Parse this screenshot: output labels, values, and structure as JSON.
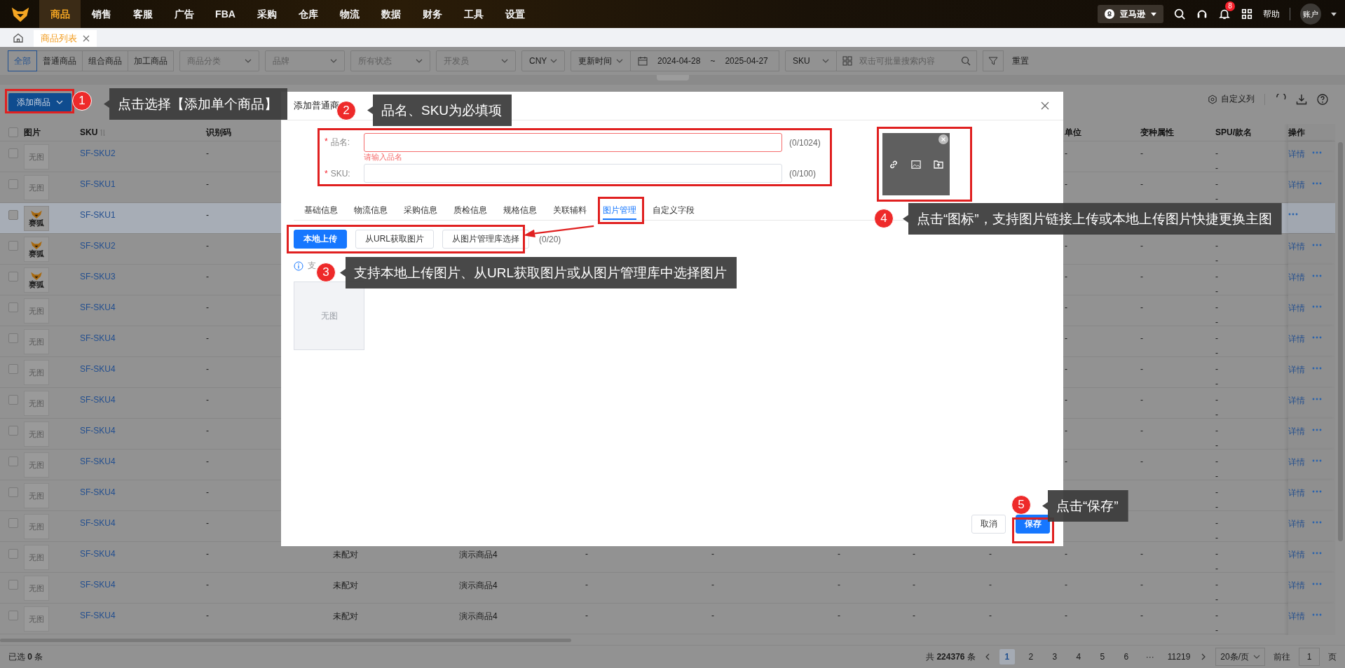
{
  "nav": {
    "items": [
      {
        "label": "商品",
        "selected": true
      },
      {
        "label": "销售",
        "selected": false
      },
      {
        "label": "客服",
        "selected": false
      },
      {
        "label": "广告",
        "selected": false
      },
      {
        "label": "FBA",
        "selected": false
      },
      {
        "label": "采购",
        "selected": false
      },
      {
        "label": "仓库",
        "selected": false
      },
      {
        "label": "物流",
        "selected": false
      },
      {
        "label": "数据",
        "selected": false
      },
      {
        "label": "财务",
        "selected": false
      },
      {
        "label": "工具",
        "selected": false
      },
      {
        "label": "设置",
        "selected": false
      }
    ],
    "marketplace": "亚马逊",
    "notification_count": "8",
    "help": "帮助",
    "account": "账户"
  },
  "tabs": [
    {
      "label": "商品列表",
      "selected": true
    }
  ],
  "filters": {
    "types": [
      {
        "label": "全部",
        "selected": true
      },
      {
        "label": "普通商品",
        "selected": false
      },
      {
        "label": "组合商品",
        "selected": false
      },
      {
        "label": "加工商品",
        "selected": false
      }
    ],
    "selects": [
      {
        "placeholder": "商品分类"
      },
      {
        "placeholder": "品牌"
      },
      {
        "placeholder": "所有状态"
      },
      {
        "placeholder": "开发员"
      },
      {
        "value": "CNY"
      }
    ],
    "date_field": "更新时间",
    "date_start": "2024-04-28",
    "date_sep": "~",
    "date_end": "2025-04-27",
    "search_field": "SKU",
    "search": {
      "placeholder": "双击可批量搜索内容"
    },
    "reset": "重置"
  },
  "toolbar": {
    "add_button": "添加商品",
    "custom_columns": "自定义列"
  },
  "table": {
    "header_checked": false,
    "header": {
      "image": "图片",
      "sku": "SKU",
      "code": "识别码",
      "unit": "单位",
      "variant": "变种属性",
      "spu": "SPU/款名",
      "actions": "操作"
    },
    "rows": [
      {
        "checked": false,
        "highlighted": false,
        "image": {
          "kind": "empty",
          "caption": "无图"
        },
        "sku": "SF-SKU2",
        "code": "-",
        "unit": "-",
        "variant": "-",
        "spu": [
          "-",
          "-"
        ],
        "detail": "详情"
      },
      {
        "checked": false,
        "highlighted": false,
        "image": {
          "kind": "empty",
          "caption": "无图"
        },
        "sku": "SF-SKU1",
        "code": "-",
        "unit": "-",
        "variant": "-",
        "spu": [
          "-",
          "-"
        ],
        "detail": "详情"
      },
      {
        "checked": false,
        "highlighted": true,
        "image": {
          "kind": "logo",
          "caption": "赛狐"
        },
        "sku": "SF-SKU1",
        "code": "-"
      },
      {
        "checked": false,
        "highlighted": false,
        "image": {
          "kind": "logo",
          "caption": "赛狐"
        },
        "sku": "SF-SKU2",
        "code": "-",
        "unit": "-",
        "variant": "-",
        "spu": [
          "-",
          "-"
        ],
        "detail": "详情"
      },
      {
        "checked": false,
        "highlighted": false,
        "image": {
          "kind": "logo",
          "caption": "赛狐"
        },
        "sku": "SF-SKU3",
        "code": "-",
        "unit": "-",
        "variant": "-",
        "spu": [
          "-",
          "-"
        ],
        "detail": "详情"
      },
      {
        "checked": false,
        "highlighted": false,
        "image": {
          "kind": "empty",
          "caption": "无图"
        },
        "sku": "SF-SKU4",
        "code": "-",
        "unit": "-",
        "variant": "-",
        "spu": [
          "-",
          "-"
        ],
        "detail": "详情"
      },
      {
        "checked": false,
        "highlighted": false,
        "image": {
          "kind": "empty",
          "caption": "无图"
        },
        "sku": "SF-SKU4",
        "code": "-",
        "unit": "-",
        "variant": "-",
        "spu": [
          "-",
          "-"
        ],
        "detail": "详情"
      },
      {
        "checked": false,
        "highlighted": false,
        "image": {
          "kind": "empty",
          "caption": "无图"
        },
        "sku": "SF-SKU4",
        "code": "-",
        "unit": "-",
        "variant": "-",
        "spu": [
          "-",
          "-"
        ],
        "detail": "详情"
      },
      {
        "checked": false,
        "highlighted": false,
        "image": {
          "kind": "empty",
          "caption": "无图"
        },
        "sku": "SF-SKU4",
        "code": "-",
        "unit": "-",
        "variant": "-",
        "spu": [
          "-",
          "-"
        ],
        "detail": "详情"
      },
      {
        "checked": false,
        "highlighted": false,
        "image": {
          "kind": "empty",
          "caption": "无图"
        },
        "sku": "SF-SKU4",
        "code": "-",
        "unit": "-",
        "variant": "-",
        "spu": [
          "-",
          "-"
        ],
        "detail": "详情"
      },
      {
        "checked": false,
        "highlighted": false,
        "image": {
          "kind": "empty",
          "caption": "无图"
        },
        "sku": "SF-SKU4",
        "code": "-",
        "unit": "-",
        "variant": "-",
        "spu": [
          "-",
          "-"
        ],
        "detail": "详情"
      },
      {
        "checked": false,
        "highlighted": false,
        "image": {
          "kind": "empty",
          "caption": "无图"
        },
        "sku": "SF-SKU4",
        "code": "-",
        "spu": [
          "-",
          "-"
        ],
        "detail": "详情"
      },
      {
        "checked": false,
        "highlighted": false,
        "image": {
          "kind": "empty",
          "caption": "无图"
        },
        "sku": "SF-SKU4",
        "code": "-",
        "spu": [
          "-",
          "-"
        ],
        "detail": "详情"
      },
      {
        "checked": false,
        "highlighted": false,
        "image": {
          "kind": "empty",
          "caption": "无图"
        },
        "sku": "SF-SKU4",
        "code": "-",
        "middle": [
          "未配对",
          "演示商品4",
          "-",
          "-",
          "-",
          "-",
          "-"
        ],
        "unit": "-",
        "variant": "-",
        "spu": [
          "-",
          "-"
        ],
        "detail": "详情"
      },
      {
        "checked": false,
        "highlighted": false,
        "image": {
          "kind": "empty",
          "caption": "无图"
        },
        "sku": "SF-SKU4",
        "code": "-",
        "middle": [
          "未配对",
          "演示商品4",
          "-",
          "-",
          "-",
          "-",
          "-"
        ],
        "unit": "-",
        "variant": "-",
        "spu": [
          "-",
          "-"
        ],
        "detail": "详情"
      },
      {
        "checked": false,
        "highlighted": false,
        "image": {
          "kind": "empty",
          "caption": "无图"
        },
        "sku": "SF-SKU4",
        "code": "-",
        "middle": [
          "未配对",
          "演示商品4",
          "-",
          "-",
          "-",
          "-",
          "-"
        ],
        "unit": "-",
        "variant": "-",
        "spu": [
          "-",
          "-"
        ],
        "detail": "详情"
      }
    ]
  },
  "footer": {
    "selected_count": "已选 **0** 条",
    "total": "共 **224376** 条",
    "pages": [
      {
        "label": "1",
        "selected": true
      },
      {
        "label": "2",
        "selected": false
      },
      {
        "label": "3",
        "selected": false
      },
      {
        "label": "4",
        "selected": false
      },
      {
        "label": "5",
        "selected": false
      },
      {
        "label": "6",
        "selected": false
      },
      {
        "label": "···",
        "selected": false
      },
      {
        "label": "11219",
        "selected": false
      }
    ],
    "page_size": "20条/页",
    "goto": "前往",
    "goto_value": "1",
    "goto_unit": "页"
  },
  "modal": {
    "title": "添加普通商",
    "fields": [
      {
        "label": "品名:",
        "required_mark": "*",
        "counter": "(0/1024)",
        "error": "请输入品名"
      },
      {
        "label": "SKU:",
        "required_mark": "*",
        "counter": "(0/100)"
      }
    ],
    "tabs": [
      {
        "label": "基础信息",
        "selected": false
      },
      {
        "label": "物流信息",
        "selected": false
      },
      {
        "label": "采购信息",
        "selected": false
      },
      {
        "label": "质检信息",
        "selected": false
      },
      {
        "label": "规格信息",
        "selected": false
      },
      {
        "label": "关联辅料",
        "selected": false
      },
      {
        "label": "图片管理",
        "selected": true
      },
      {
        "label": "自定义字段",
        "selected": false
      }
    ],
    "upload_buttons": [
      {
        "label": "本地上传",
        "primary": true
      },
      {
        "label": "从URL获取图片",
        "primary": false
      },
      {
        "label": "从图片管理库选择",
        "primary": false
      }
    ],
    "image_count": "(0/20)",
    "info": "支",
    "placeholder": "无图",
    "cancel": "取消",
    "save": "保存"
  },
  "annotations": [
    {
      "number": "1",
      "text": "点击选择【添加单个商品】"
    },
    {
      "number": "2",
      "text": "品名、SKU为必填项"
    },
    {
      "number": "3",
      "text": "支持本地上传图片、从URL获取图片或从图片管理库中选择图片"
    },
    {
      "number": "4",
      "text": "点击“图标”，支持图片链接上传或本地上传图片快捷更换主图"
    },
    {
      "number": "5",
      "text": "点击“保存”"
    }
  ]
}
